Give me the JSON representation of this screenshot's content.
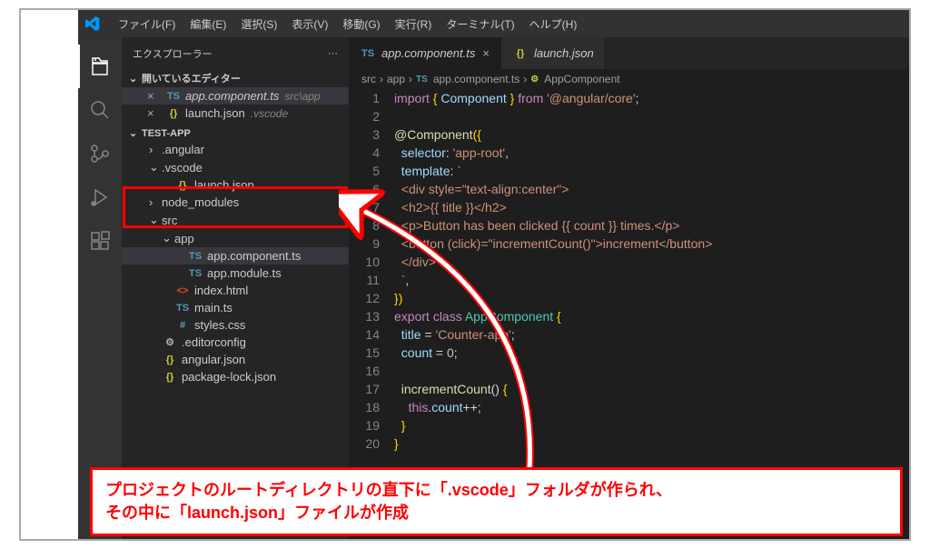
{
  "menu": [
    "ファイル(F)",
    "編集(E)",
    "選択(S)",
    "表示(V)",
    "移動(G)",
    "実行(R)",
    "ターミナル(T)",
    "ヘルプ(H)"
  ],
  "sidebar": {
    "title": "エクスプローラー",
    "openEditorsLabel": "開いているエディター",
    "projectName": "TEST-APP",
    "openEditors": [
      {
        "icon": "TS",
        "iconClass": "icon-ts",
        "name": "app.component.ts",
        "path": "src\\app",
        "active": true
      },
      {
        "icon": "{}",
        "iconClass": "icon-json",
        "name": "launch.json",
        "path": ".vscode",
        "active": false
      }
    ],
    "tree": [
      {
        "type": "folder",
        "name": ".angular",
        "expanded": false,
        "indent": 1
      },
      {
        "type": "folder",
        "name": ".vscode",
        "expanded": true,
        "indent": 1
      },
      {
        "type": "file",
        "name": "launch.json",
        "icon": "{}",
        "iconClass": "icon-json",
        "indent": 2
      },
      {
        "type": "folder",
        "name": "node_modules",
        "expanded": false,
        "indent": 1
      },
      {
        "type": "folder",
        "name": "src",
        "expanded": true,
        "indent": 1
      },
      {
        "type": "folder",
        "name": "app",
        "expanded": true,
        "indent": 2
      },
      {
        "type": "file",
        "name": "app.component.ts",
        "icon": "TS",
        "iconClass": "icon-ts",
        "indent": 3,
        "active": true
      },
      {
        "type": "file",
        "name": "app.module.ts",
        "icon": "TS",
        "iconClass": "icon-ts",
        "indent": 3
      },
      {
        "type": "file",
        "name": "index.html",
        "icon": "<>",
        "iconClass": "icon-html",
        "indent": 2
      },
      {
        "type": "file",
        "name": "main.ts",
        "icon": "TS",
        "iconClass": "icon-ts",
        "indent": 2
      },
      {
        "type": "file",
        "name": "styles.css",
        "icon": "#",
        "iconClass": "icon-css",
        "indent": 2
      },
      {
        "type": "file",
        "name": ".editorconfig",
        "icon": "⚙",
        "iconClass": "icon-editorconfig",
        "indent": 1
      },
      {
        "type": "file",
        "name": "angular.json",
        "icon": "{}",
        "iconClass": "icon-json",
        "indent": 1
      },
      {
        "type": "file",
        "name": "package-lock.json",
        "icon": "{}",
        "iconClass": "icon-json",
        "indent": 1
      }
    ]
  },
  "tabs": [
    {
      "icon": "TS",
      "iconClass": "icon-ts",
      "label": "app.component.ts",
      "active": true
    },
    {
      "icon": "{}",
      "iconClass": "icon-json",
      "label": "launch.json",
      "active": false
    }
  ],
  "breadcrumb": {
    "parts": [
      "src",
      "app",
      "app.component.ts",
      "AppComponent"
    ],
    "icons": [
      "",
      "",
      "TS",
      "⚙"
    ]
  },
  "code": {
    "lines": [
      [
        {
          "t": "import ",
          "c": "tk-kw"
        },
        {
          "t": "{ ",
          "c": "tk-br"
        },
        {
          "t": "Component",
          "c": "tk-id"
        },
        {
          "t": " } ",
          "c": "tk-br"
        },
        {
          "t": "from ",
          "c": "tk-kw"
        },
        {
          "t": "'@angular/core'",
          "c": "tk-str"
        },
        {
          "t": ";",
          "c": "tk-plain"
        }
      ],
      [],
      [
        {
          "t": "@",
          "c": "tk-dec"
        },
        {
          "t": "Component",
          "c": "tk-dec"
        },
        {
          "t": "(",
          "c": "tk-br"
        },
        {
          "t": "{",
          "c": "tk-br"
        }
      ],
      [
        {
          "t": "  selector",
          "c": "tk-id"
        },
        {
          "t": ": ",
          "c": "tk-plain"
        },
        {
          "t": "'app-root'",
          "c": "tk-str"
        },
        {
          "t": ",",
          "c": "tk-plain"
        }
      ],
      [
        {
          "t": "  template",
          "c": "tk-id"
        },
        {
          "t": ": ",
          "c": "tk-plain"
        },
        {
          "t": "`",
          "c": "tk-str"
        }
      ],
      [
        {
          "t": "  <div style=\"text-align:center\">",
          "c": "tk-str"
        }
      ],
      [
        {
          "t": "  <h2>{{ title }}</h2>",
          "c": "tk-str"
        }
      ],
      [
        {
          "t": "  <p>Button has been clicked {{ count }} times.</p>",
          "c": "tk-str"
        }
      ],
      [
        {
          "t": "  <button (click)=\"incrementCount()\">increment</button>",
          "c": "tk-str"
        }
      ],
      [
        {
          "t": "  </div>",
          "c": "tk-str"
        }
      ],
      [
        {
          "t": "  `",
          "c": "tk-str"
        },
        {
          "t": ",",
          "c": "tk-plain"
        }
      ],
      [
        {
          "t": "}",
          "c": "tk-br"
        },
        {
          "t": ")",
          "c": "tk-br"
        }
      ],
      [
        {
          "t": "export ",
          "c": "tk-kw"
        },
        {
          "t": "class ",
          "c": "tk-kw"
        },
        {
          "t": "AppComponent ",
          "c": "tk-cls"
        },
        {
          "t": "{",
          "c": "tk-br"
        }
      ],
      [
        {
          "t": "  title ",
          "c": "tk-id"
        },
        {
          "t": "= ",
          "c": "tk-plain"
        },
        {
          "t": "'Counter-app'",
          "c": "tk-str"
        },
        {
          "t": ";",
          "c": "tk-plain"
        }
      ],
      [
        {
          "t": "  count ",
          "c": "tk-id"
        },
        {
          "t": "= ",
          "c": "tk-plain"
        },
        {
          "t": "0",
          "c": "tk-num"
        },
        {
          "t": ";",
          "c": "tk-plain"
        }
      ],
      [],
      [
        {
          "t": "  ",
          "c": ""
        },
        {
          "t": "incrementCount",
          "c": "tk-fn"
        },
        {
          "t": "() ",
          "c": "tk-plain"
        },
        {
          "t": "{",
          "c": "tk-br"
        }
      ],
      [
        {
          "t": "    ",
          "c": ""
        },
        {
          "t": "this",
          "c": "tk-kw"
        },
        {
          "t": ".",
          "c": "tk-plain"
        },
        {
          "t": "count",
          "c": "tk-id"
        },
        {
          "t": "++;",
          "c": "tk-plain"
        }
      ],
      [
        {
          "t": "  }",
          "c": "tk-br"
        }
      ],
      [
        {
          "t": "}",
          "c": "tk-br"
        }
      ]
    ]
  },
  "annotation": {
    "line1": "プロジェクトのルートディレクトリの直下に「.vscode」フォルダが作られ、",
    "line2": "その中に「launch.json」ファイルが作成"
  }
}
